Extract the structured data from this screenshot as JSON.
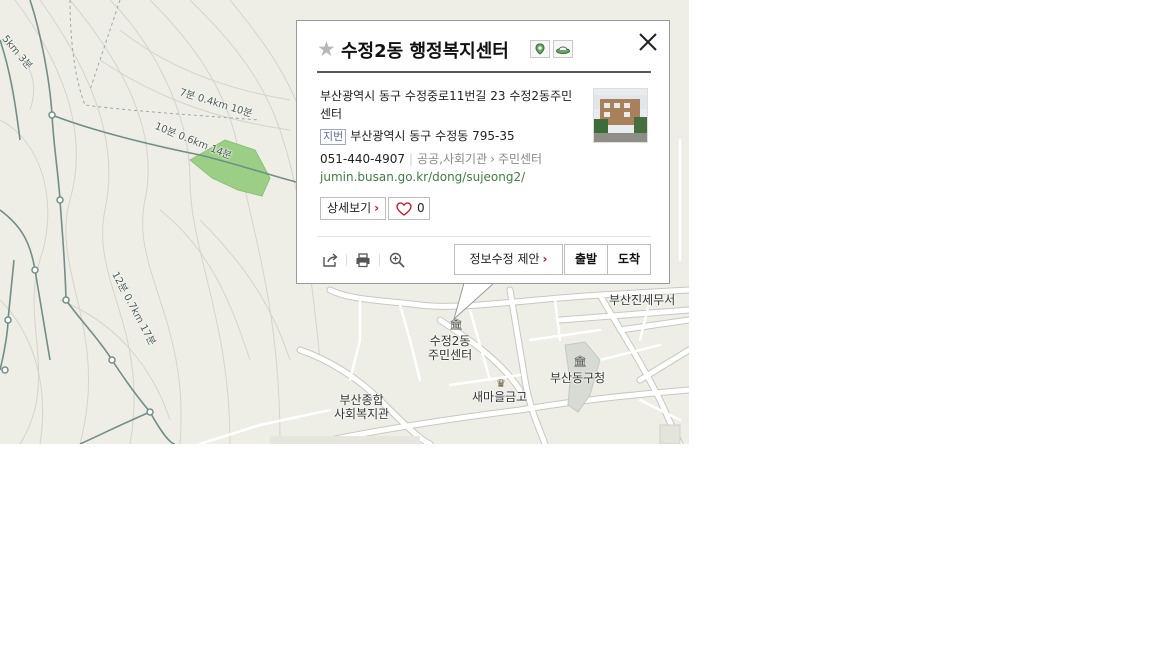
{
  "popup": {
    "title": "수정2동 행정복지센터",
    "address_road": "부산광역시 동구 수정중로11번길 23 수정2동주민센터",
    "jibun_label": "지번",
    "address_jibun": "부산광역시 동구 수정동 795-35",
    "phone": "051-440-4907",
    "category_parent": "공공,사회기관",
    "category_child": "주민센터",
    "url": "jumin.busan.go.kr/dong/sujeong2/",
    "detail_button": "상세보기",
    "like_count": "0",
    "suggest_button": "정보수정 제안",
    "depart_button": "출발",
    "arrive_button": "도착",
    "icons": [
      "star-icon",
      "marker-tag-icon",
      "ufo-tag-icon",
      "close-icon",
      "share-icon",
      "print-icon",
      "zoom-icon",
      "heart-icon"
    ]
  },
  "map": {
    "labels": {
      "poi_center": "수정2동\n주민센터",
      "busan_donggu_office": "부산동구청",
      "saemaeul": "새마을금고",
      "busanjin_tax": "부산진세무서",
      "welfare": "부산종합\n사회복지관",
      "trail_1": "7분 0.4km 10분",
      "trail_2": "10분 0.6km 14분",
      "trail_3": "12분 0.7km 17분",
      "trail_4": "5km 3분"
    },
    "colors": {
      "background": "#eeeee6",
      "contour": "#d6d6cc",
      "trail": "#6f8f87",
      "park": "#9ccf86",
      "road": "#ffffff",
      "road_outline": "#c8c8c0"
    }
  }
}
